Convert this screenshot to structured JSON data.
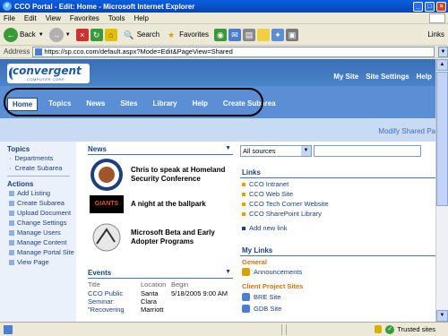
{
  "window": {
    "title": "CCO Portal - Edit: Home - Microsoft Internet Explorer"
  },
  "menu": [
    "File",
    "Edit",
    "View",
    "Favorites",
    "Tools",
    "Help"
  ],
  "toolbar": {
    "back": "Back",
    "search": "Search",
    "favorites": "Favorites",
    "links": "Links"
  },
  "address": {
    "label": "Address",
    "url": "https://sp.cco.com/default.aspx?Mode=Edit&PageView=Shared"
  },
  "site": {
    "logo": "convergent",
    "logo_sub": "COMPUTER CORP.",
    "top_links": [
      "My Site",
      "Site Settings",
      "Help"
    ],
    "nav": [
      "Home",
      "Topics",
      "News",
      "Sites",
      "Library",
      "Help",
      "Create Subarea"
    ],
    "modify_link": "Modify Shared Pa"
  },
  "sidebar": {
    "topics_header": "Topics",
    "topics": [
      "Departments",
      "Create Subarea"
    ],
    "actions_header": "Actions",
    "actions": [
      "Add Listing",
      "Create Subarea",
      "Upload Document",
      "Change Settings",
      "Manage Users",
      "Manage Content",
      "Manage Portal Site",
      "View Page"
    ]
  },
  "news": {
    "header": "News",
    "items": [
      "Chris to speak at Homeland Security Conference",
      "A night at the ballpark",
      "Microsoft Beta and Early Adopter Programs"
    ],
    "giants_label": "GIANTS"
  },
  "events": {
    "header": "Events",
    "columns": [
      "Title",
      "Location",
      "Begin"
    ],
    "rows": [
      {
        "title": [
          "CCO Public",
          "Seminar:",
          "\"Recovering"
        ],
        "location": [
          "Santa",
          "Clara",
          "Marriott"
        ],
        "begin": "5/18/2005 9:00 AM"
      }
    ]
  },
  "search": {
    "scope": "All sources"
  },
  "links": {
    "header": "Links",
    "items": [
      "CCO Intranet",
      "CCO Web Site",
      "CCO Tech Corner Website",
      "CCO SharePoint Library"
    ],
    "add": "Add new link"
  },
  "my_links": {
    "header": "My Links",
    "general_header": "General",
    "general": [
      "Announcements"
    ],
    "client_header": "Client Project Sites",
    "client": [
      "BRE Site",
      "GDB Site"
    ]
  },
  "status": {
    "zone": "Trusted sites"
  },
  "colors": {
    "banner": "#3a6fb4",
    "nav": "#5a8fd6",
    "accent": "#1d3f80"
  }
}
